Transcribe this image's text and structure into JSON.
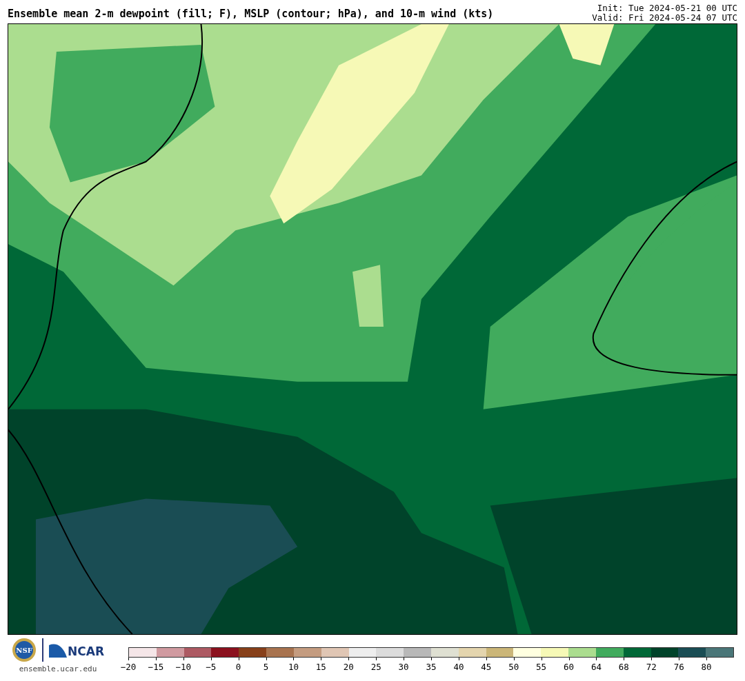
{
  "title": "Ensemble mean 2-m dewpoint (fill; F), MSLP (contour; hPa), and 10-m wind (kts)",
  "times": [
    "Init: Tue 2024-05-21 00 UTC",
    "Valid: Fri 2024-05-24 07 UTC"
  ],
  "logos": {
    "nsf": "NSF",
    "ncar": "NCAR",
    "url": "ensemble.ucar.edu"
  },
  "colorbar": {
    "bins": [
      {
        "color": "#f5e6e8"
      },
      {
        "color": "#d09aa0"
      },
      {
        "color": "#ad5a63"
      },
      {
        "color": "#8b111e"
      },
      {
        "color": "#87401a"
      },
      {
        "color": "#a8734f"
      },
      {
        "color": "#c49c80"
      },
      {
        "color": "#e0c6b4"
      },
      {
        "color": "#eeeeee"
      },
      {
        "color": "#dcdcdc"
      },
      {
        "color": "#b8b8b8"
      },
      {
        "color": "#dfe0d2"
      },
      {
        "color": "#e4d5ae"
      },
      {
        "color": "#cbb678"
      },
      {
        "color": "#ffffe0"
      },
      {
        "color": "#f6f9b6"
      },
      {
        "color": "#abdd8f"
      },
      {
        "color": "#41ab5d"
      },
      {
        "color": "#006837"
      },
      {
        "color": "#00432a"
      },
      {
        "color": "#1a4d54"
      },
      {
        "color": "#4a7678"
      }
    ],
    "ticks": [
      "−20",
      "−15",
      "−10",
      "−5",
      "0",
      "5",
      "10",
      "15",
      "20",
      "25",
      "30",
      "35",
      "40",
      "45",
      "50",
      "55",
      "60",
      "64",
      "68",
      "72",
      "76",
      "80"
    ]
  }
}
